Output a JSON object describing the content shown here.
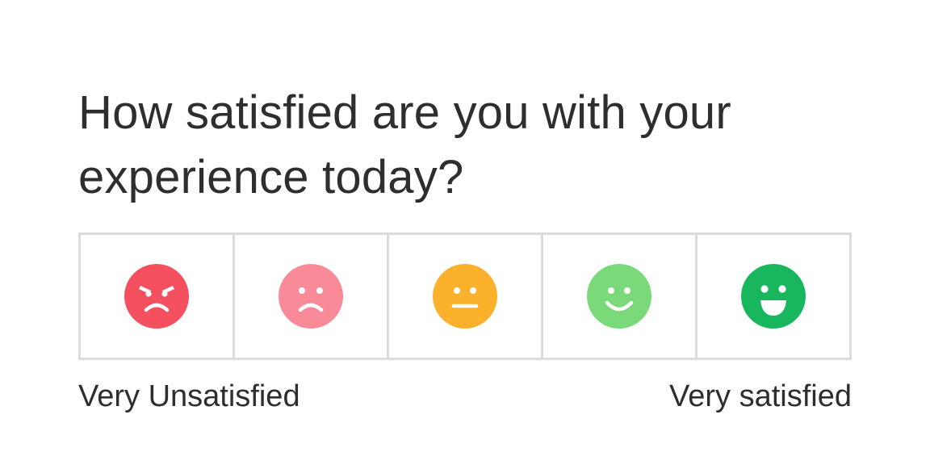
{
  "question": {
    "line1": "How satisfied are you with your",
    "line2": "experience today?"
  },
  "scale": {
    "options": [
      {
        "rating": 1,
        "icon": "angry-face-icon",
        "color": "#f4505f"
      },
      {
        "rating": 2,
        "icon": "sad-face-icon",
        "color": "#f98b99"
      },
      {
        "rating": 3,
        "icon": "neutral-face-icon",
        "color": "#fbb12c"
      },
      {
        "rating": 4,
        "icon": "smile-face-icon",
        "color": "#7ad978"
      },
      {
        "rating": 5,
        "icon": "grin-face-icon",
        "color": "#18b75e"
      }
    ],
    "min_label": "Very Unsatisfied",
    "max_label": "Very satisfied"
  }
}
